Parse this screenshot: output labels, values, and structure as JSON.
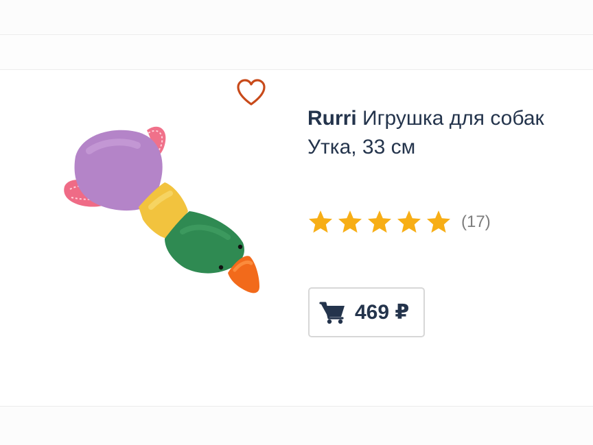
{
  "product": {
    "brand": "Rurri",
    "name": " Игрушка для собак Утка, 33 см",
    "rating": {
      "stars": 5,
      "max": 5,
      "review_count": "(17)"
    },
    "price": "469 ₽",
    "image_alt": "Игрушка для собак Утка"
  },
  "icons": {
    "favorite": "heart-outline-icon",
    "cart": "shopping-cart-icon",
    "star": "star-icon"
  },
  "colors": {
    "heart": "#c84a1a",
    "star": "#f7ae16",
    "text": "#24344c",
    "muted": "#7c7c7c"
  }
}
